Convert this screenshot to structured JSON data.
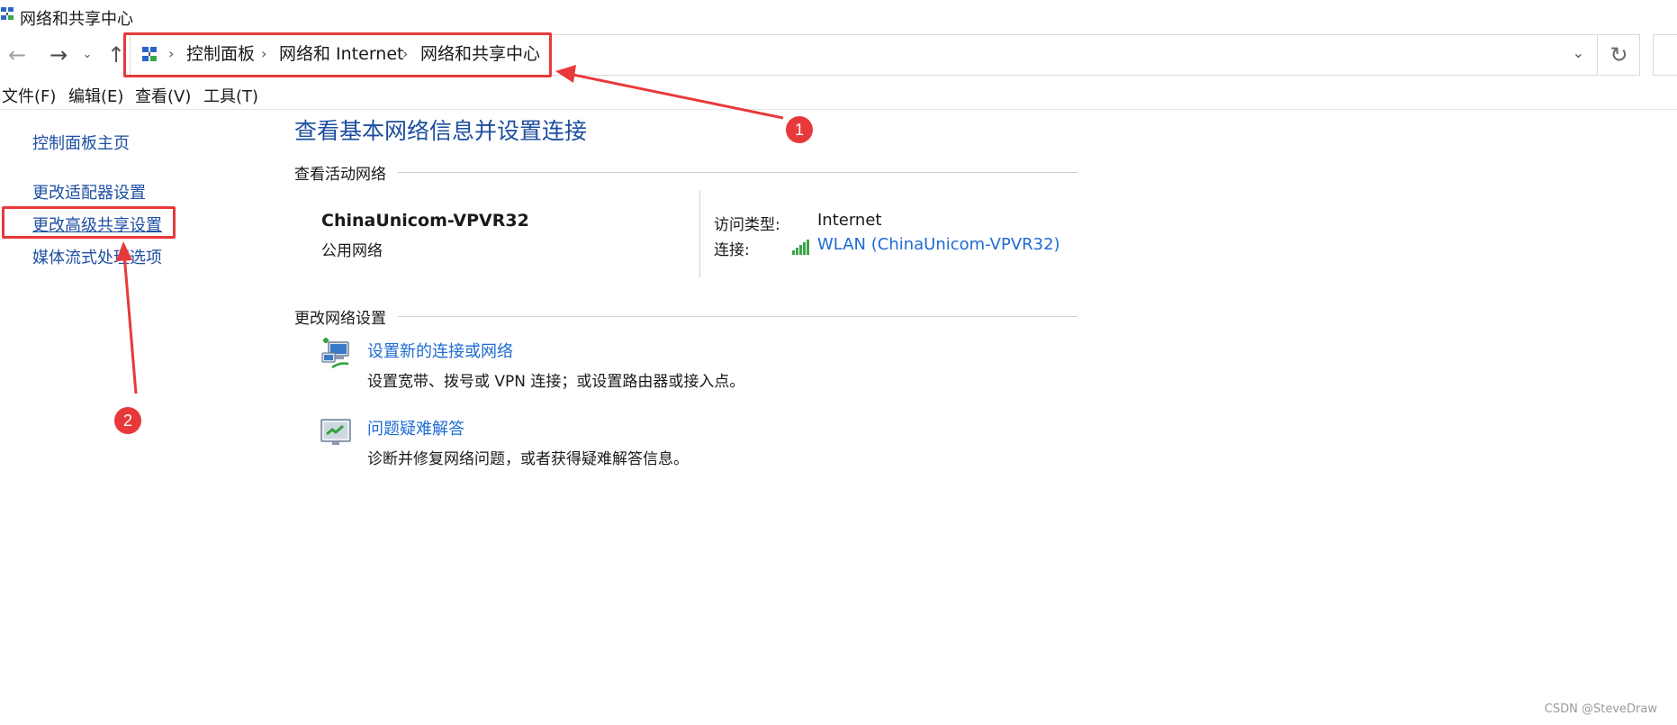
{
  "window": {
    "title": "网络和共享中心"
  },
  "address": {
    "breadcrumbs": [
      {
        "label": "控制面板"
      },
      {
        "label": "网络和 Internet"
      },
      {
        "label": "网络和共享中心"
      }
    ]
  },
  "menu": {
    "items": [
      {
        "label": "文件(F)"
      },
      {
        "label": "编辑(E)"
      },
      {
        "label": "查看(V)"
      },
      {
        "label": "工具(T)"
      }
    ]
  },
  "sidebar": {
    "items": [
      {
        "label": "控制面板主页"
      },
      {
        "label": "更改适配器设置"
      },
      {
        "label": "更改高级共享设置"
      },
      {
        "label": "媒体流式处理选项"
      }
    ]
  },
  "main": {
    "title": "查看基本网络信息并设置连接",
    "active_section": "查看活动网络",
    "network": {
      "name": "ChinaUnicom-VPVR32",
      "type": "公用网络",
      "access_type_label": "访问类型:",
      "access_type_value": "Internet",
      "connection_label": "连接:",
      "connection_value": "WLAN (ChinaUnicom-VPVR32)"
    },
    "change_section": "更改网络设置",
    "tasks": [
      {
        "label": "设置新的连接或网络",
        "desc": "设置宽带、拨号或 VPN 连接；或设置路由器或接入点。"
      },
      {
        "label": "问题疑难解答",
        "desc": "诊断并修复网络问题，或者获得疑难解答信息。"
      }
    ]
  },
  "annotations": {
    "marker1": "1",
    "marker2": "2"
  },
  "watermark": "CSDN @SteveDraw",
  "colors": {
    "link": "#1e6bd1",
    "title": "#1d4ea0",
    "annotation": "#e8393a"
  }
}
